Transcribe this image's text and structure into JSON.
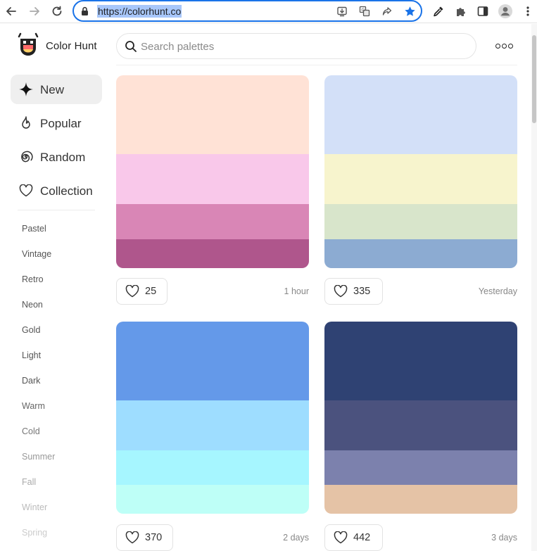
{
  "browser": {
    "url": "https://colorhunt.co"
  },
  "site": {
    "brand": "Color Hunt",
    "search_placeholder": "Search palettes"
  },
  "sidebar": {
    "nav": [
      {
        "label": "New",
        "icon": "sparkle-icon",
        "active": true
      },
      {
        "label": "Popular",
        "icon": "flame-icon",
        "active": false
      },
      {
        "label": "Random",
        "icon": "spiral-icon",
        "active": false
      },
      {
        "label": "Collection",
        "icon": "heart-outline-icon",
        "active": false
      }
    ],
    "tags": [
      {
        "label": "Pastel",
        "color": "#555555"
      },
      {
        "label": "Vintage",
        "color": "#555555"
      },
      {
        "label": "Retro",
        "color": "#555555"
      },
      {
        "label": "Neon",
        "color": "#555555"
      },
      {
        "label": "Gold",
        "color": "#555555"
      },
      {
        "label": "Light",
        "color": "#555555"
      },
      {
        "label": "Dark",
        "color": "#555555"
      },
      {
        "label": "Warm",
        "color": "#666666"
      },
      {
        "label": "Cold",
        "color": "#777777"
      },
      {
        "label": "Summer",
        "color": "#999999"
      },
      {
        "label": "Fall",
        "color": "#aaaaaa"
      },
      {
        "label": "Winter",
        "color": "#bbbbbb"
      },
      {
        "label": "Spring",
        "color": "#cccccc"
      }
    ]
  },
  "palettes": [
    {
      "colors": [
        "#FFE2D6",
        "#F9C8EA",
        "#D986B6",
        "#AF568C"
      ],
      "likes": "25",
      "time": "1 hour"
    },
    {
      "colors": [
        "#D3E0F8",
        "#F7F4CD",
        "#D8E5CB",
        "#8CABD2"
      ],
      "likes": "335",
      "time": "Yesterday"
    },
    {
      "colors": [
        "#6499E9",
        "#9EDDFF",
        "#A6F6FF",
        "#BEFFF7"
      ],
      "likes": "370",
      "time": "2 days"
    },
    {
      "colors": [
        "#2F4273",
        "#4B527E",
        "#7C81AD",
        "#E5C3A6"
      ],
      "likes": "442",
      "time": "3 days"
    }
  ]
}
